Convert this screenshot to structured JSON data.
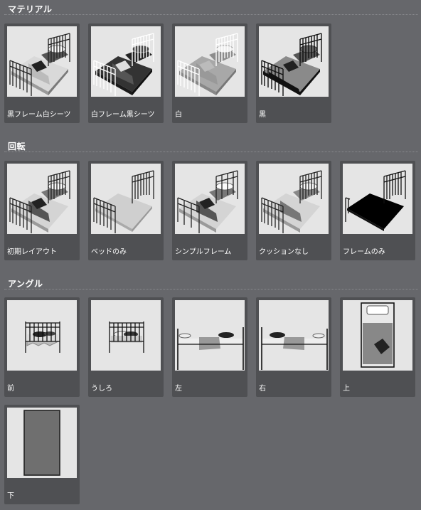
{
  "sections": [
    {
      "title": "マテリアル",
      "items": [
        {
          "label": "黒フレーム白シーツ",
          "icon": "bed-black-frame-white-sheet"
        },
        {
          "label": "白フレーム黒シーツ",
          "icon": "bed-white-frame-black-sheet"
        },
        {
          "label": "白",
          "icon": "bed-white"
        },
        {
          "label": "黒",
          "icon": "bed-black"
        }
      ]
    },
    {
      "title": "回転",
      "items": [
        {
          "label": "初期レイアウト",
          "icon": "bed-initial-layout"
        },
        {
          "label": "ベッドのみ",
          "icon": "bed-only"
        },
        {
          "label": "シンプルフレーム",
          "icon": "bed-simple-frame"
        },
        {
          "label": "クッションなし",
          "icon": "bed-no-cushion"
        },
        {
          "label": "フレームのみ",
          "icon": "bed-frame-only"
        }
      ]
    },
    {
      "title": "アングル",
      "items": [
        {
          "label": "前",
          "icon": "bed-front-view"
        },
        {
          "label": "うしろ",
          "icon": "bed-back-view"
        },
        {
          "label": "左",
          "icon": "bed-left-view"
        },
        {
          "label": "右",
          "icon": "bed-right-view"
        },
        {
          "label": "上",
          "icon": "bed-top-view"
        },
        {
          "label": "下",
          "icon": "bed-bottom-view"
        }
      ]
    }
  ]
}
